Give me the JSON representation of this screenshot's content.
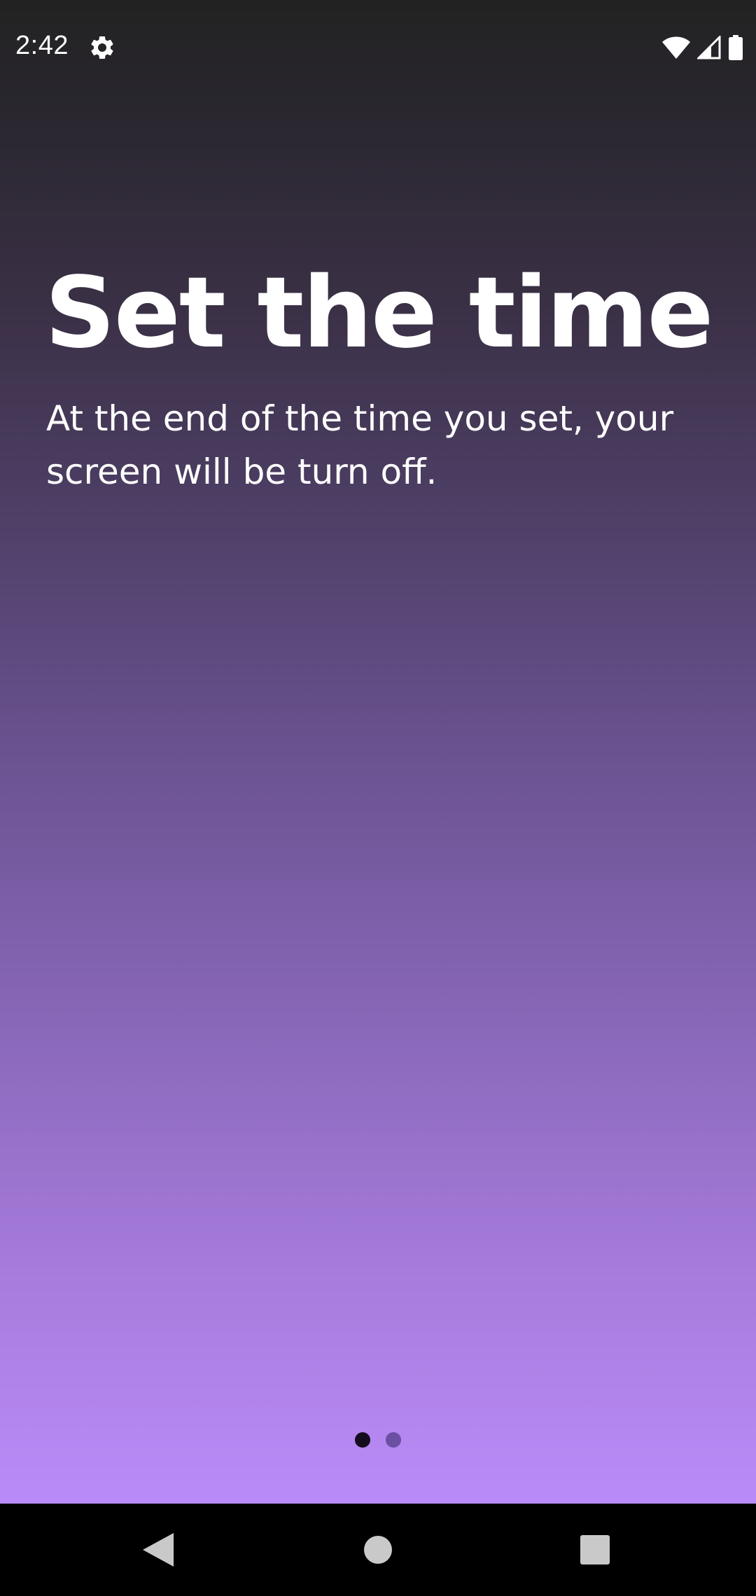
{
  "status_bar": {
    "time": "2:42",
    "icons": [
      "settings-gear-icon",
      "wifi-icon",
      "cellular-signal-icon",
      "battery-icon"
    ]
  },
  "onboarding": {
    "title": "Set the time",
    "subtitle": "At the end of the time you set, your screen will be turn off.",
    "page_indicator": {
      "total_pages": 2,
      "current_page": 1
    }
  },
  "colors": {
    "gradient_top": "#222222",
    "gradient_bottom": "#b98bf9",
    "text": "#ffffff",
    "dot_active": "#150d1e",
    "dot_inactive": "#6a4fa3",
    "nav_bar": "#000000"
  },
  "nav_bar": {
    "buttons": [
      "back-icon",
      "home-icon",
      "recents-icon"
    ]
  }
}
